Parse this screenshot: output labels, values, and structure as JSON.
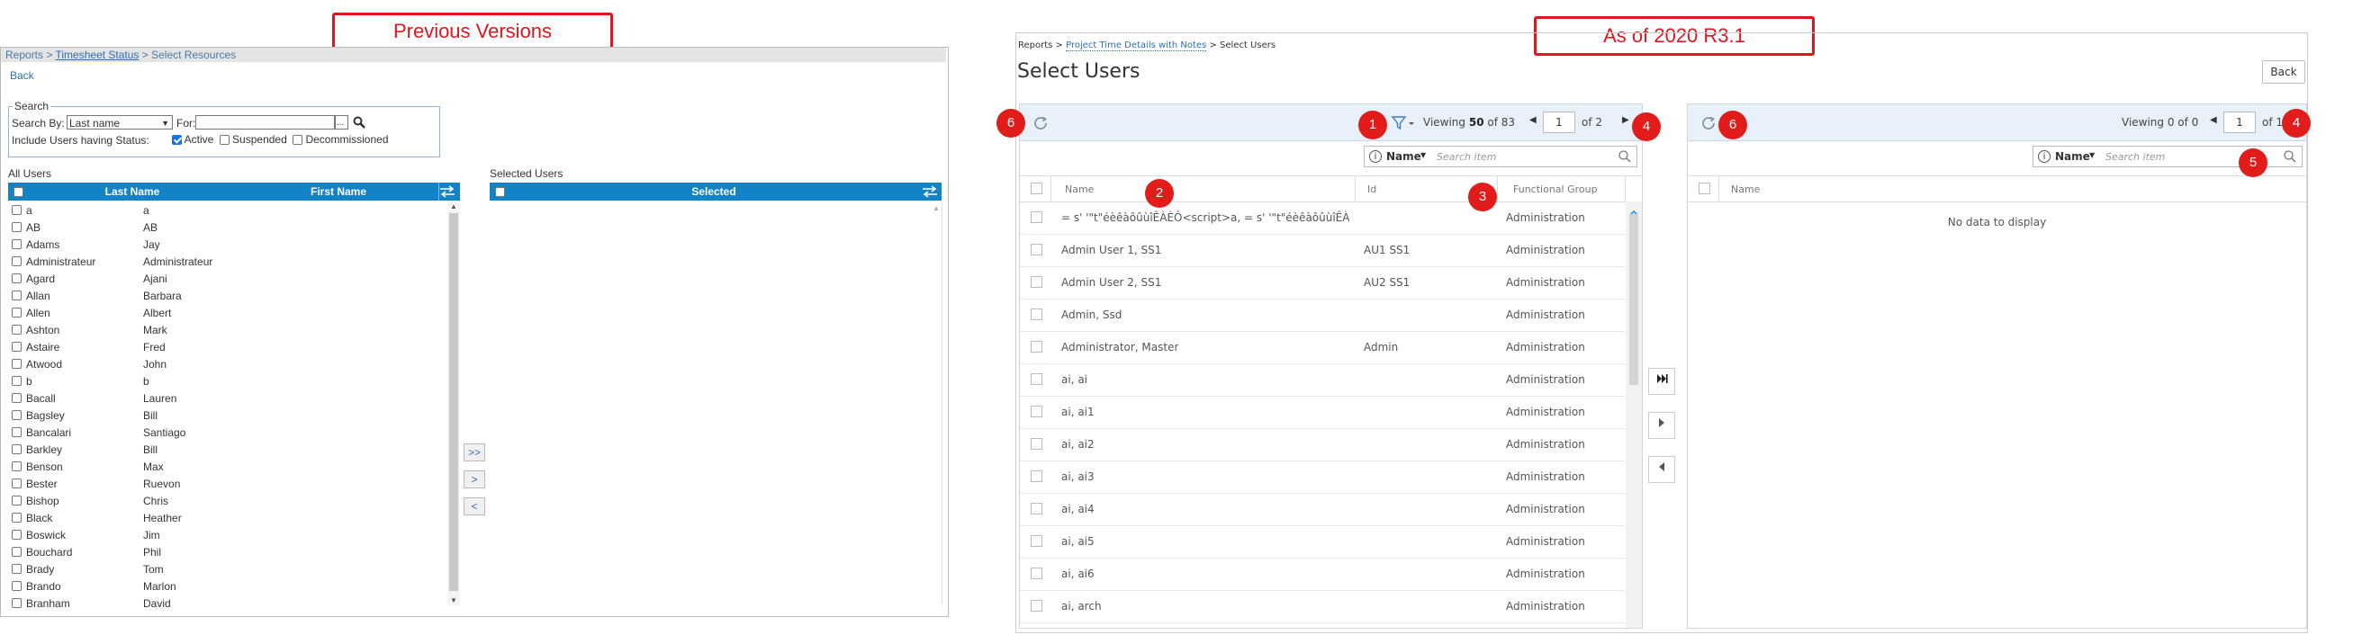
{
  "labels": {
    "previous": "Previous Versions",
    "current": "As of 2020 R3.1"
  },
  "old": {
    "breadcrumb": {
      "reports": "Reports",
      "sep1": " > ",
      "timesheet": "Timesheet Status",
      "sep2": " > ",
      "select": "Select Resources"
    },
    "back": "Back",
    "search_legend": "Search",
    "search_by_label": "Search By:",
    "search_by_value": "Last name",
    "for_label": "For:",
    "for_value": "",
    "ellipsis": "...",
    "include_label": "Include Users having Status:",
    "status": [
      {
        "label": "Active",
        "checked": true
      },
      {
        "label": "Suspended",
        "checked": false
      },
      {
        "label": "Decommissioned",
        "checked": false
      }
    ],
    "all_users_label": "All Users",
    "selected_users_label": "Selected Users",
    "col_last": "Last Name",
    "col_first": "First Name",
    "col_selected": "Selected",
    "move_all": ">>",
    "move_one": ">",
    "move_back": "<",
    "rows": [
      [
        "a",
        "a"
      ],
      [
        "AB",
        "AB"
      ],
      [
        "Adams",
        "Jay"
      ],
      [
        "Administrateur",
        "Administrateur"
      ],
      [
        "Agard",
        "Ajani"
      ],
      [
        "Allan",
        "Barbara"
      ],
      [
        "Allen",
        "Albert"
      ],
      [
        "Ashton",
        "Mark"
      ],
      [
        "Astaire",
        "Fred"
      ],
      [
        "Atwood",
        "John"
      ],
      [
        "b",
        "b"
      ],
      [
        "Bacall",
        "Lauren"
      ],
      [
        "Bagsley",
        "Bill"
      ],
      [
        "Bancalari",
        "Santiago"
      ],
      [
        "Barkley",
        "Bill"
      ],
      [
        "Benson",
        "Max"
      ],
      [
        "Bester",
        "Ruevon"
      ],
      [
        "Bishop",
        "Chris"
      ],
      [
        "Black",
        "Heather"
      ],
      [
        "Boswick",
        "Jim"
      ],
      [
        "Bouchard",
        "Phil"
      ],
      [
        "Brady",
        "Tom"
      ],
      [
        "Brando",
        "Marlon"
      ],
      [
        "Branham",
        "David"
      ]
    ]
  },
  "new": {
    "breadcrumb": {
      "reports": "Reports",
      "sep1": " > ",
      "project": "Project Time Details with Notes",
      "sep2": " > ",
      "select": "Select Users"
    },
    "title": "Select Users",
    "back": "Back",
    "left": {
      "viewing_prefix": "Viewing ",
      "viewing_count": "50",
      "viewing_suffix": " of 83",
      "page": "1",
      "of_pages": "of 2",
      "search_field": "Name",
      "search_placeholder": "Search item",
      "col_name": "Name",
      "col_id": "Id",
      "col_group": "Functional Group",
      "rows": [
        {
          "name": "= s' '\"t\"éèêàôûùîÊÀÈÔ<script>a, = s' '\"t\"éèêàôûùîÊÀ...",
          "id": "",
          "group": "Administration"
        },
        {
          "name": "Admin User 1, SS1",
          "id": "AU1 SS1",
          "group": "Administration"
        },
        {
          "name": "Admin User 2, SS1",
          "id": "AU2 SS1",
          "group": "Administration"
        },
        {
          "name": "Admin, Ssd",
          "id": "",
          "group": "Administration"
        },
        {
          "name": "Administrator, Master",
          "id": "Admin",
          "group": "Administration"
        },
        {
          "name": "ai, ai",
          "id": "",
          "group": "Administration"
        },
        {
          "name": "ai, ai1",
          "id": "",
          "group": "Administration"
        },
        {
          "name": "ai, ai2",
          "id": "",
          "group": "Administration"
        },
        {
          "name": "ai, ai3",
          "id": "",
          "group": "Administration"
        },
        {
          "name": "ai, ai4",
          "id": "",
          "group": "Administration"
        },
        {
          "name": "ai, ai5",
          "id": "",
          "group": "Administration"
        },
        {
          "name": "ai, ai6",
          "id": "",
          "group": "Administration"
        },
        {
          "name": "ai, arch",
          "id": "",
          "group": "Administration"
        }
      ]
    },
    "right": {
      "viewing": "Viewing 0 of 0",
      "page": "1",
      "of_pages": "of 1",
      "search_field": "Name",
      "search_placeholder": "Search item",
      "col_name": "Name",
      "empty": "No data to display"
    },
    "badges": {
      "b1": "1",
      "b2": "2",
      "b3": "3",
      "b4": "4",
      "b5": "5",
      "b6": "6"
    }
  }
}
